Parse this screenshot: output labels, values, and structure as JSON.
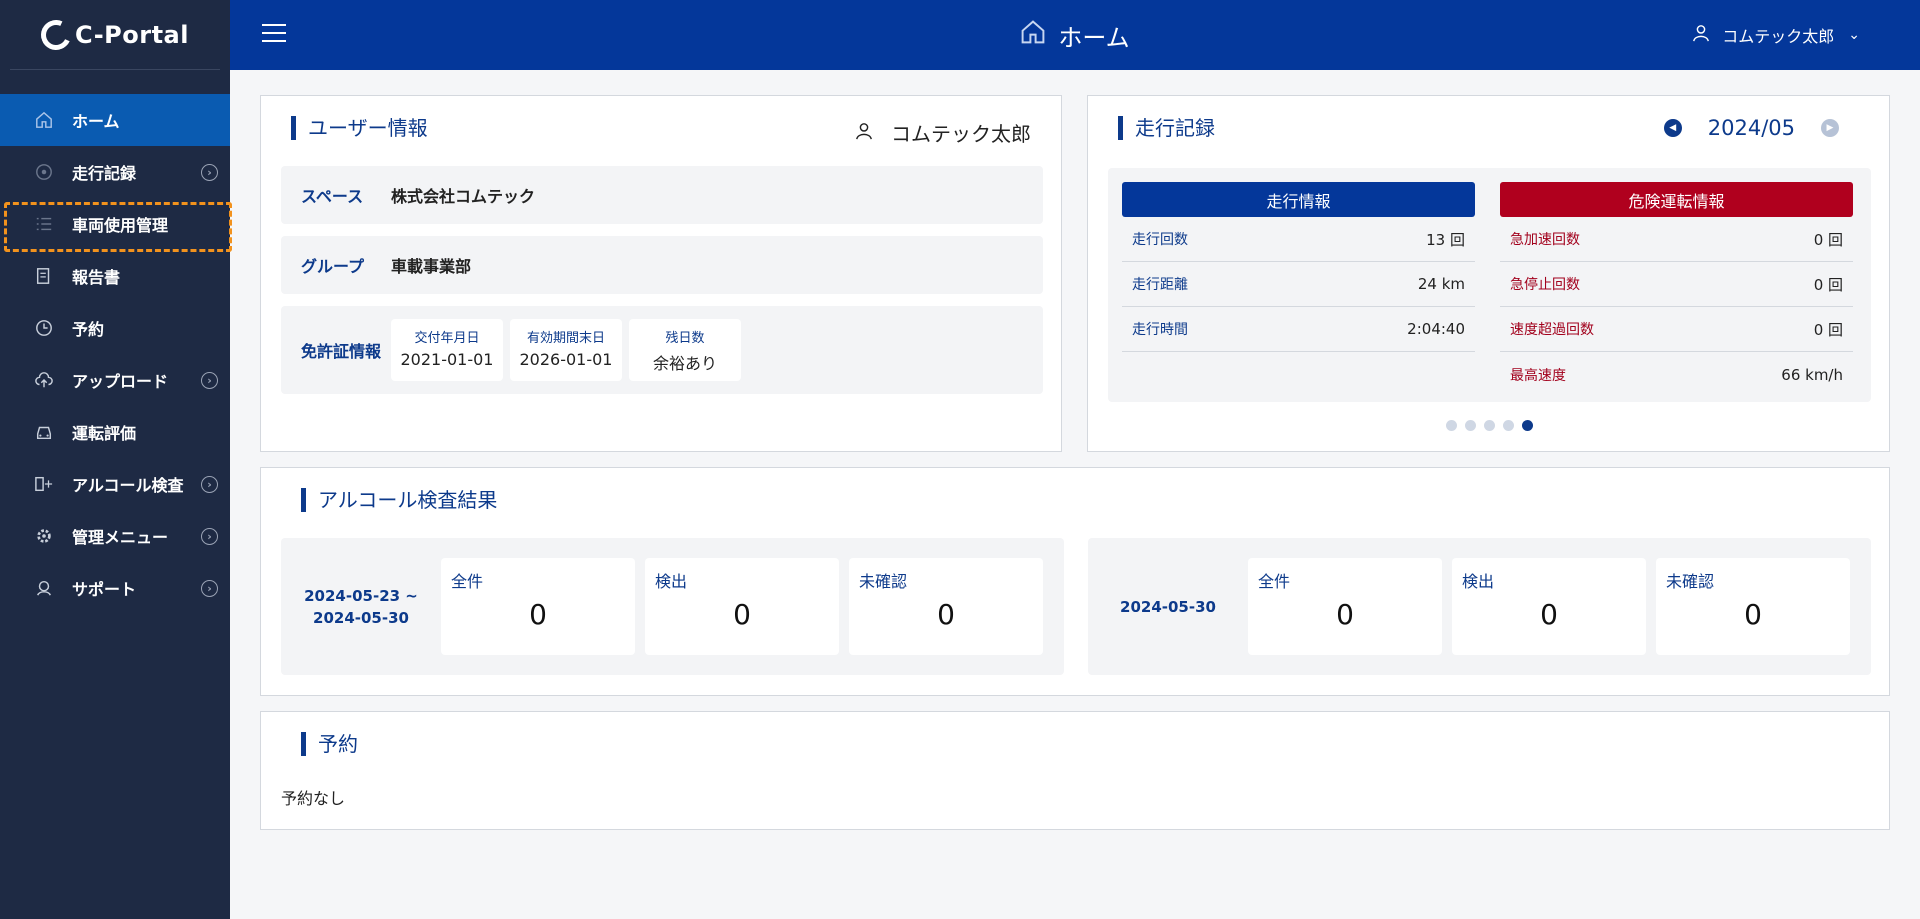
{
  "app": {
    "logo_text": "C-Portal"
  },
  "header": {
    "title": "ホーム",
    "user_name": "コムテック太郎"
  },
  "sidebar": {
    "items": [
      {
        "label": "ホーム",
        "icon": "home-icon",
        "active": true,
        "has_chevron": false
      },
      {
        "label": "走行記録",
        "icon": "steering-icon",
        "has_chevron": true
      },
      {
        "label": "車両使用管理",
        "icon": "list-icon",
        "has_chevron": false,
        "highlight": true
      },
      {
        "label": "報告書",
        "icon": "report-icon",
        "has_chevron": false
      },
      {
        "label": "予約",
        "icon": "clock-icon",
        "has_chevron": false
      },
      {
        "label": "アップロード",
        "icon": "cloud-upload-icon",
        "has_chevron": true
      },
      {
        "label": "運転評価",
        "icon": "car-icon",
        "has_chevron": false
      },
      {
        "label": "アルコール検査",
        "icon": "alcohol-icon",
        "has_chevron": true
      },
      {
        "label": "管理メニュー",
        "icon": "gear-icon",
        "has_chevron": true
      },
      {
        "label": "サポート",
        "icon": "support-icon",
        "has_chevron": true
      }
    ]
  },
  "user_info": {
    "title": "ユーザー情報",
    "user_name": "コムテック太郎",
    "space_label": "スペース",
    "space_value": "株式会社コムテック",
    "group_label": "グループ",
    "group_value": "車載事業部",
    "license_label": "免許証情報",
    "license": [
      {
        "label": "交付年月日",
        "value": "2021-01-01"
      },
      {
        "label": "有効期間末日",
        "value": "2026-01-01"
      },
      {
        "label": "残日数",
        "value": "余裕あり"
      }
    ]
  },
  "drive_record": {
    "title": "走行記録",
    "month": "2024/05",
    "info_header": "走行情報",
    "danger_header": "危険運転情報",
    "info_rows": [
      {
        "label": "走行回数",
        "value": "13 回"
      },
      {
        "label": "走行距離",
        "value": "24 km"
      },
      {
        "label": "走行時間",
        "value": "2:04:40"
      }
    ],
    "danger_rows": [
      {
        "label": "急加速回数",
        "value": "0 回"
      },
      {
        "label": "急停止回数",
        "value": "0 回"
      },
      {
        "label": "速度超過回数",
        "value": "0 回"
      },
      {
        "label": "最高速度",
        "value": "66 km/h"
      }
    ],
    "page_count": 5,
    "current_page": 5
  },
  "alcohol": {
    "title": "アルコール検査結果",
    "panels": [
      {
        "date_line1": "2024-05-23 ~",
        "date_line2": "2024-05-30",
        "stats": [
          {
            "label": "全件",
            "value": "0"
          },
          {
            "label": "検出",
            "value": "0"
          },
          {
            "label": "未確認",
            "value": "0"
          }
        ]
      },
      {
        "date_line1": "2024-05-30",
        "date_line2": "",
        "stats": [
          {
            "label": "全件",
            "value": "0"
          },
          {
            "label": "検出",
            "value": "0"
          },
          {
            "label": "未確認",
            "value": "0"
          }
        ]
      }
    ]
  },
  "reservation": {
    "title": "予約",
    "empty_text": "予約なし"
  },
  "colors": {
    "sidebar": "#1e2a44",
    "header": "#04379a",
    "active": "#0a5bb1",
    "danger": "#b0001e",
    "highlight": "#f2921d"
  }
}
